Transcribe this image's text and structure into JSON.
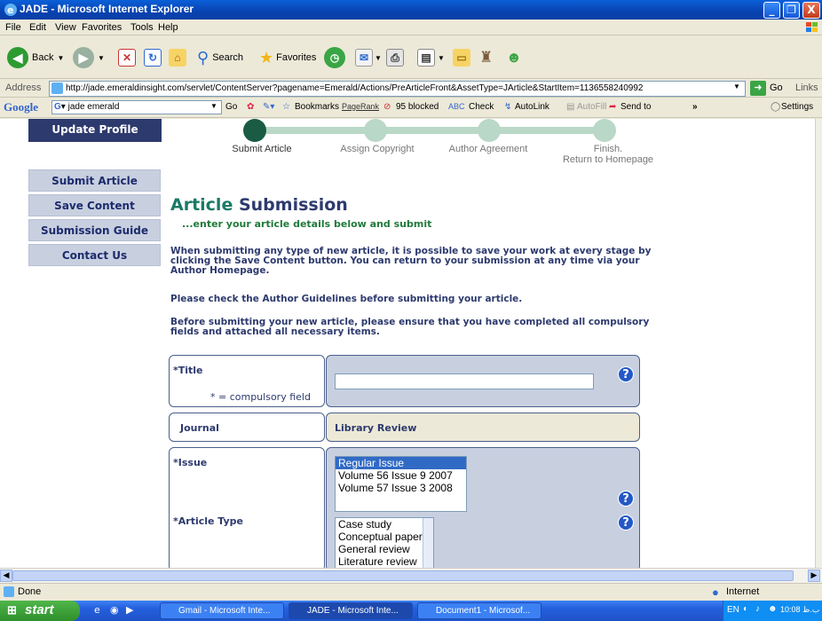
{
  "window": {
    "title": "JADE - Microsoft Internet Explorer",
    "controls": [
      "_",
      "❐",
      "X"
    ]
  },
  "menu": [
    "File",
    "Edit",
    "View",
    "Favorites",
    "Tools",
    "Help"
  ],
  "toolbar": {
    "back": "Back",
    "search": "Search",
    "favorites": "Favorites"
  },
  "address": {
    "label": "Address",
    "url": "http://jade.emeraldinsight.com/servlet/ContentServer?pagename=Emerald/Actions/PreArticleFront&AssetType=JArticle&StartItem=1136558240992",
    "go": "Go",
    "links": "Links"
  },
  "googlebar": {
    "logo": "Google",
    "query": "jade emerald",
    "go": "Go",
    "bookmarks": "Bookmarks",
    "pagerank": "PageRank",
    "blocked": "95 blocked",
    "check": "Check",
    "autolink": "AutoLink",
    "autofill": "AutoFill",
    "sendto": "Send to",
    "settings": "Settings"
  },
  "sidebar": {
    "top": "Update Profile",
    "items": [
      "Submit Article",
      "Save Content",
      "Submission Guide",
      "Contact Us"
    ]
  },
  "progress": {
    "steps": [
      "Submit Article",
      "Assign Copyright",
      "Author Agreement",
      "Finish.\nReturn to Homepage"
    ],
    "active_step": 0
  },
  "article": {
    "title_a": "Article",
    "title_b": "Submission",
    "subtitle": "...enter your article details below and submit",
    "p1": "When submitting any type of new article, it is possible to save your work at every stage by clicking the Save Content button. You can return to your submission at any time via your Author Homepage.",
    "p2": "Please check the Author Guidelines before submitting your article.",
    "p3": "Before submitting your new article, please ensure that you have completed all compulsory fields and attached all necessary items."
  },
  "form": {
    "title_label": "*Title",
    "compulsory_note": "* = compulsory field",
    "title_value": "",
    "journal_label": "Journal",
    "journal_value": "Library Review",
    "issue_label": "*Issue",
    "issue_options": [
      "Regular Issue",
      "Volume 56 Issue 9 2007",
      "Volume 57 Issue 3 2008"
    ],
    "issue_selected": "Regular Issue",
    "type_label": "*Article Type",
    "type_options": [
      "Case study",
      "Conceptual paper",
      "General review",
      "Literature review"
    ],
    "help_glyph": "?"
  },
  "status": {
    "left": "Done",
    "zone": "Internet"
  },
  "taskbar": {
    "start": "start",
    "tasks": [
      "Gmail - Microsoft Inte...",
      "JADE - Microsoft Inte...",
      "Document1 - Microsof..."
    ],
    "lang": "EN",
    "clock": "10:08 ب.ظ"
  },
  "colors": {
    "navy": "#2d3a6e",
    "green": "#1a7a66",
    "sidebar_bg": "#c8d0e0",
    "progress_active": "#1a5b43",
    "progress_inactive": "#b9d8c7"
  }
}
